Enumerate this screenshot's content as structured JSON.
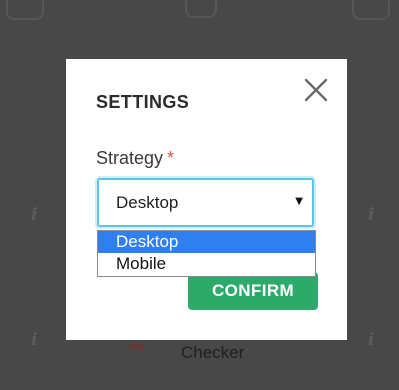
{
  "background": {
    "checker_text": "Checker",
    "badge_text": ".org"
  },
  "modal": {
    "title": "SETTINGS",
    "close_icon": "close-icon",
    "strategy": {
      "label": "Strategy",
      "required_mark": "*",
      "selected_value": "Desktop",
      "options": [
        "Desktop",
        "Mobile"
      ],
      "highlighted_option": "Desktop"
    },
    "confirm_label": "CONFIRM"
  },
  "colors": {
    "overlay": "#484848",
    "accent_focus": "#5fc3e8",
    "option_highlight": "#2f7ff0",
    "confirm_green": "#2daa6a",
    "required_red": "#e34d4d"
  }
}
